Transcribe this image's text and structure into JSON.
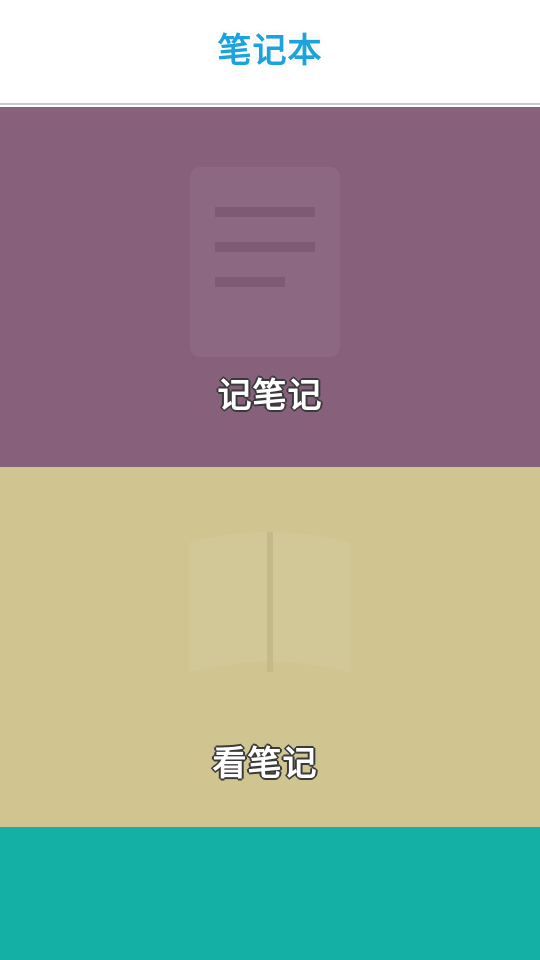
{
  "header": {
    "title": "笔记本"
  },
  "panels": {
    "write": {
      "label": "记笔记",
      "icon": "pencil-note-icon",
      "color": "#87607c"
    },
    "read": {
      "label": "看笔记",
      "icon": "notebook-icon",
      "color": "#d0c490"
    },
    "bottom": {
      "color": "#14b0a6"
    }
  },
  "colors": {
    "title": "#1aa3dc",
    "header_bg": "#ffffff",
    "label_text": "#ffffff"
  }
}
